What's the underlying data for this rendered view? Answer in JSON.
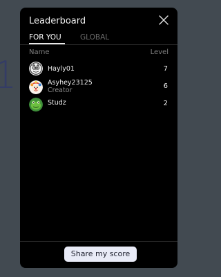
{
  "backdrop": {
    "digit": "1"
  },
  "modal": {
    "title": "Leaderboard",
    "close_icon": "close-icon"
  },
  "tabs": [
    {
      "label": "FOR YOU",
      "active": true
    },
    {
      "label": "GLOBAL",
      "active": false
    }
  ],
  "columns": {
    "name": "Name",
    "level": "Level"
  },
  "players": [
    {
      "name": "Hayly01",
      "role": "",
      "level": "7",
      "avatar": "owl-avatar"
    },
    {
      "name": "Asyhey23125",
      "role": "Creator",
      "level": "6",
      "avatar": "clown-avatar"
    },
    {
      "name": "Studz",
      "role": "",
      "level": "2",
      "avatar": "frog-avatar"
    }
  ],
  "footer": {
    "share_label": "Share my score"
  },
  "colors": {
    "page_background": "#424a51",
    "modal_background": "#000000",
    "button_background": "#e9ebf7",
    "inactive_tab": "#6b6b6b"
  }
}
